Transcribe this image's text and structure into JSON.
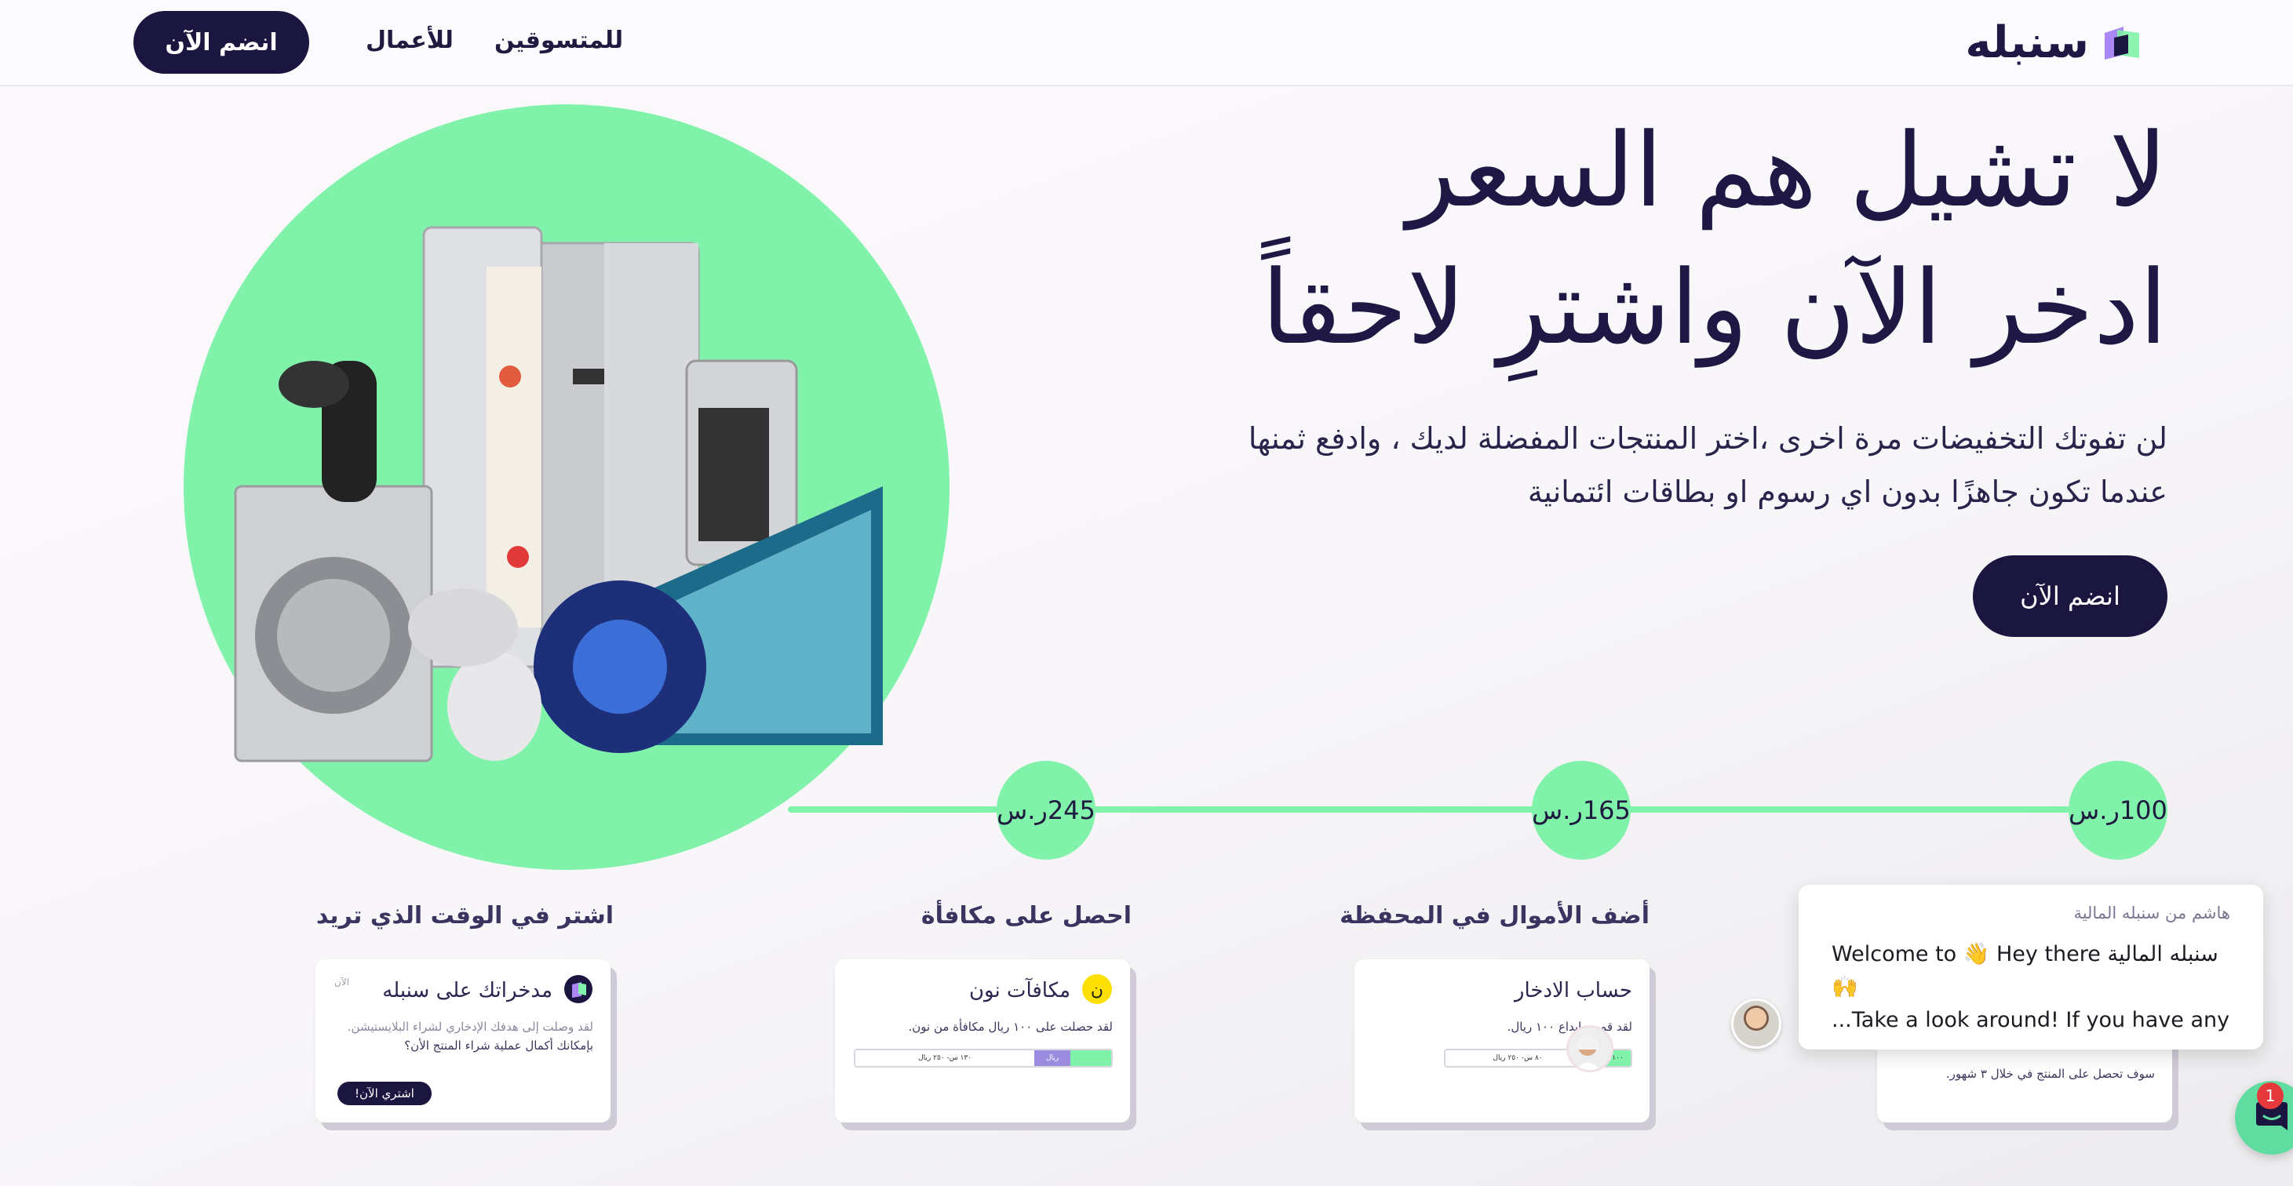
{
  "header": {
    "logo_text": "سنبله",
    "nav": [
      {
        "label": "للمتسوقين"
      },
      {
        "label": "للأعمال"
      }
    ],
    "join_label": "انضم الآن"
  },
  "hero": {
    "title_line1": "لا تشيل هم السعر",
    "title_line2": "ادخر الآن واشترِ لاحقاً",
    "desc_line1": "لن تفوتك التخفيضات مرة اخرى ،اختر المنتجات المفضلة لديك ، وادفع ثمنها",
    "desc_line2": "عندما تكون جاهزًا بدون اي رسوم او بطاقات ائتمانية",
    "join_label": "انضم الآن"
  },
  "timeline": {
    "steps": [
      {
        "amount": "100ر.س"
      },
      {
        "amount": "165ر.س"
      },
      {
        "amount": "245ر.س"
      }
    ]
  },
  "cards": [
    {
      "section_title": "أضف الأموال في المحفظة",
      "title": "حساب الادخار",
      "text": "لقد قمت بإيداع ١٠٠ ريال.",
      "progress_filled": "١٠٠ ريال",
      "progress_rest": "٨٠ س- ٢٥٠ ريال",
      "progress_fraction": 0.22
    },
    {
      "section_title": "احصل على مكافأة",
      "title": "مكافآت نون",
      "text": "لقد حصلت على ١٠٠ ريال مكافأة من نون.",
      "progress_filled": "",
      "progress_mid": "ريال",
      "progress_rest": "١٣٠ س- ٢٥٠ ريال",
      "progress_fraction": 0.3
    },
    {
      "section_title": "اشتر في الوقت الذي تريد",
      "title": "مدخراتك على سنبله",
      "time": "الآن",
      "text_line1": "لقد وصلت إلى هدفك الإدخاري لشراء البلايستيشن.",
      "text_line2": "بإمكانك أكمال عملية شراء المنتج الأن؟",
      "button_label": "اشتري الآن!"
    },
    {
      "text": "سوف تحصل على المنتج في خلال ٣ شهور."
    }
  ],
  "chat": {
    "sender": "هاشم من سنبله المالية",
    "message_line1": "Welcome to 👋 Hey there سنبله المالية 🙌",
    "message_line2": "...Take a look around! If you have any",
    "badge_count": "1"
  },
  "colors": {
    "brand_navy": "#1b1640",
    "accent_green": "#80f2a9",
    "purple": "#9b8ce0"
  }
}
